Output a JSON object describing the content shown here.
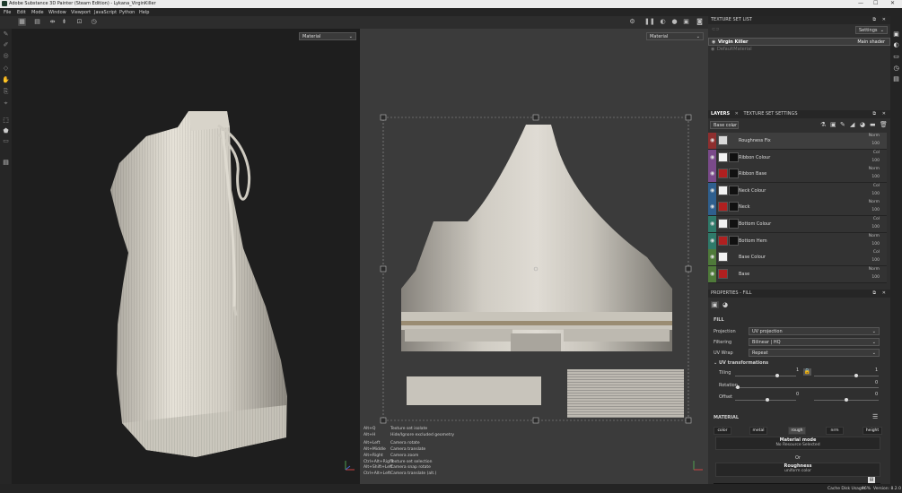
{
  "window": {
    "title": "Adobe Substance 3D Painter (Steam Edition) - Lykana_VirginKiller",
    "minimize": "—",
    "maximize": "☐",
    "close": "✕"
  },
  "menu": [
    "File",
    "Edit",
    "Mode",
    "Window",
    "Viewport",
    "JavaScript",
    "Python",
    "Help"
  ],
  "viewport3d": {
    "material_select": "Material"
  },
  "viewport2d": {
    "material_select": "Material"
  },
  "shortcuts": [
    {
      "key": "Alt+Q",
      "action": "Texture set isolate"
    },
    {
      "key": "Alt+H",
      "action": "Hide/Ignore excluded geometry"
    },
    {
      "key": "Alt+Left",
      "action": "Camera rotate"
    },
    {
      "key": "Alt+Middle",
      "action": "Camera translate"
    },
    {
      "key": "Alt+Right",
      "action": "Camera zoom"
    },
    {
      "key": "Ctrl+Alt+Right",
      "action": "Texture set selection"
    },
    {
      "key": "Alt+Shift+Left",
      "action": "Camera snap rotate"
    },
    {
      "key": "Ctrl+Alt+Left",
      "action": "Camera translate (alt.)"
    }
  ],
  "texture_set_list": {
    "title": "TEXTURE SET LIST",
    "settings": "Settings",
    "items": [
      {
        "name": "Virgin Killer",
        "shader": "Main shader"
      },
      {
        "name": "DefaultMaterial",
        "shader": ""
      }
    ]
  },
  "layers_panel": {
    "tab_layers": "LAYERS",
    "tab_tss": "TEXTURE SET SETTINGS",
    "channel": "Base color",
    "layers": [
      {
        "name": "Roughness Fix",
        "blend": "Norm",
        "opacity": "100",
        "color": "#8e2f2f",
        "thumb": "#d8d8d8",
        "mask": ""
      },
      {
        "name": "Ribbon Colour",
        "blend": "Col",
        "opacity": "100",
        "color": "#7a4a8a",
        "thumb": "#f2f2f2",
        "mask": "#111111"
      },
      {
        "name": "Ribbon Base",
        "blend": "Norm",
        "opacity": "100",
        "color": "#7a4a8a",
        "thumb": "#b02020",
        "mask": "#111111"
      },
      {
        "name": "Neck Colour",
        "blend": "Col",
        "opacity": "100",
        "color": "#2f5f8e",
        "thumb": "#f2f2f2",
        "mask": "#111111"
      },
      {
        "name": "Neck",
        "blend": "Norm",
        "opacity": "100",
        "color": "#2f5f8e",
        "thumb": "#b02020",
        "mask": "#111111"
      },
      {
        "name": "Bottom Colour",
        "blend": "Col",
        "opacity": "100",
        "color": "#2f7a6a",
        "thumb": "#f2f2f2",
        "mask": "#111111"
      },
      {
        "name": "Bottom Hem",
        "blend": "Norm",
        "opacity": "100",
        "color": "#2f7a6a",
        "thumb": "#b02020",
        "mask": "#111111"
      },
      {
        "name": "Base Colour",
        "blend": "Col",
        "opacity": "100",
        "color": "#4f7a3a",
        "thumb": "#f2f2f2",
        "mask": ""
      },
      {
        "name": "Base",
        "blend": "Norm",
        "opacity": "100",
        "color": "#4f7a3a",
        "thumb": "#b02020",
        "mask": ""
      }
    ]
  },
  "properties": {
    "title": "PROPERTIES - FILL",
    "section": "FILL",
    "projection_label": "Projection",
    "projection_value": "UV projection",
    "filtering_label": "Filtering",
    "filtering_value": "Bilinear | HQ",
    "uvwrap_label": "UV Wrap",
    "uvwrap_value": "Repeat",
    "uvt_title": "UV transformations",
    "tiling_label": "Tiling",
    "tiling_value": "1",
    "tiling_value2": "1",
    "rotation_label": "Rotation",
    "rotation_value": "0",
    "offset_label": "Offset",
    "offset_value": "0",
    "offset_value2": "0",
    "material_title": "MATERIAL",
    "channels": [
      "color",
      "metal",
      "rough",
      "nrm",
      "height"
    ],
    "material_mode_label": "Material mode",
    "material_mode_value": "No Resource Selected",
    "or": "Or",
    "roughness_label": "Roughness",
    "roughness_value": "uniform color"
  },
  "status": {
    "cache": "Cache Disk Usage:",
    "cache_value": "96%",
    "version": "Version: 8.2.0"
  }
}
